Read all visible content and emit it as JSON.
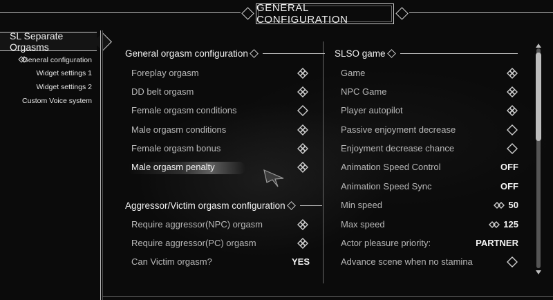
{
  "header": {
    "title": "GENERAL CONFIGURATION"
  },
  "sidebar": {
    "mod_title": "SL Separate Orgasms",
    "pages": [
      {
        "label": "General configuration"
      },
      {
        "label": "Widget settings 1"
      },
      {
        "label": "Widget settings 2"
      },
      {
        "label": "Custom Voice system"
      }
    ]
  },
  "left": {
    "section1_title": "General orgasm configuration",
    "options1": [
      {
        "label": "Foreplay orgasm",
        "state": "checked"
      },
      {
        "label": "DD belt orgasm",
        "state": "checked"
      },
      {
        "label": "Female orgasm conditions",
        "state": "unchecked"
      },
      {
        "label": "Male orgasm conditions",
        "state": "checked"
      },
      {
        "label": "Female orgasm bonus",
        "state": "checked"
      },
      {
        "label": "Male orgasm penalty",
        "state": "checked"
      }
    ],
    "section2_title": "Aggressor/Victim orgasm configuration",
    "options2": [
      {
        "label": "Require aggressor(NPC) orgasm",
        "state": "checked"
      },
      {
        "label": "Require aggressor(PC) orgasm",
        "state": "checked"
      },
      {
        "label": "Can Victim orgasm?",
        "value": "YES"
      }
    ]
  },
  "right": {
    "section_title": "SLSO game",
    "options": [
      {
        "label": "Game",
        "state": "checked"
      },
      {
        "label": "NPC Game",
        "state": "checked"
      },
      {
        "label": "Player autopilot",
        "state": "checked"
      },
      {
        "label": "Passive enjoyment decrease",
        "state": "unchecked"
      },
      {
        "label": "Enjoyment decrease chance",
        "state": "unchecked"
      },
      {
        "label": "Animation Speed Control",
        "value": "OFF"
      },
      {
        "label": "Animation Speed Sync",
        "value": "OFF"
      },
      {
        "label": "Min speed",
        "value": "50",
        "slider_icon": "slider-icon"
      },
      {
        "label": "Max speed",
        "value": "125",
        "slider_icon": "slider-icon"
      },
      {
        "label": "Actor pleasure priority:",
        "value": "PARTNER"
      },
      {
        "label": "Advance scene when no stamina",
        "state": "unchecked"
      }
    ]
  },
  "icons": {
    "checked": "checkbox-checked-icon",
    "unchecked": "checkbox-unchecked-icon",
    "page_selector": "page-selector-icon",
    "cursor": "cursor-arrow-icon"
  },
  "colors": {
    "text": "#b8b8b8",
    "highlight_text": "#f2f2f2",
    "lines": "#bdbdbd"
  }
}
